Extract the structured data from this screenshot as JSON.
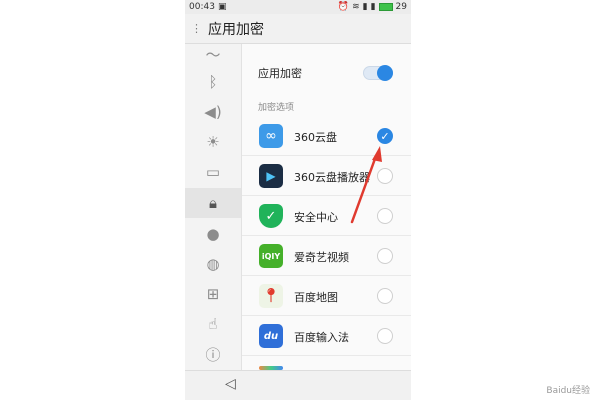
{
  "status": {
    "time": "00:43",
    "battery": "29"
  },
  "header": {
    "title": "应用加密"
  },
  "main": {
    "toggle_label": "应用加密",
    "toggle_on": true,
    "section_label": "加密选项",
    "apps": [
      {
        "name": "360云盘",
        "checked": true,
        "icon": "cloud-icon",
        "color": "#3d9ae8"
      },
      {
        "name": "360云盘播放器",
        "checked": false,
        "icon": "play-icon",
        "color": "#1b2d44"
      },
      {
        "name": "安全中心",
        "checked": false,
        "icon": "shield-check-icon",
        "color": "#20b35a"
      },
      {
        "name": "爱奇艺视频",
        "checked": false,
        "icon": "iqiyi-icon",
        "color": "#45b02a"
      },
      {
        "name": "百度地图",
        "checked": false,
        "icon": "map-pin-icon",
        "color": "#e23b2e"
      },
      {
        "name": "百度输入法",
        "checked": false,
        "icon": "du-icon",
        "color": "#2f6fd8"
      }
    ]
  },
  "colors": {
    "accent": "#2b87e3",
    "annotation": "#e03a2f"
  },
  "watermark": "Baidu经验"
}
